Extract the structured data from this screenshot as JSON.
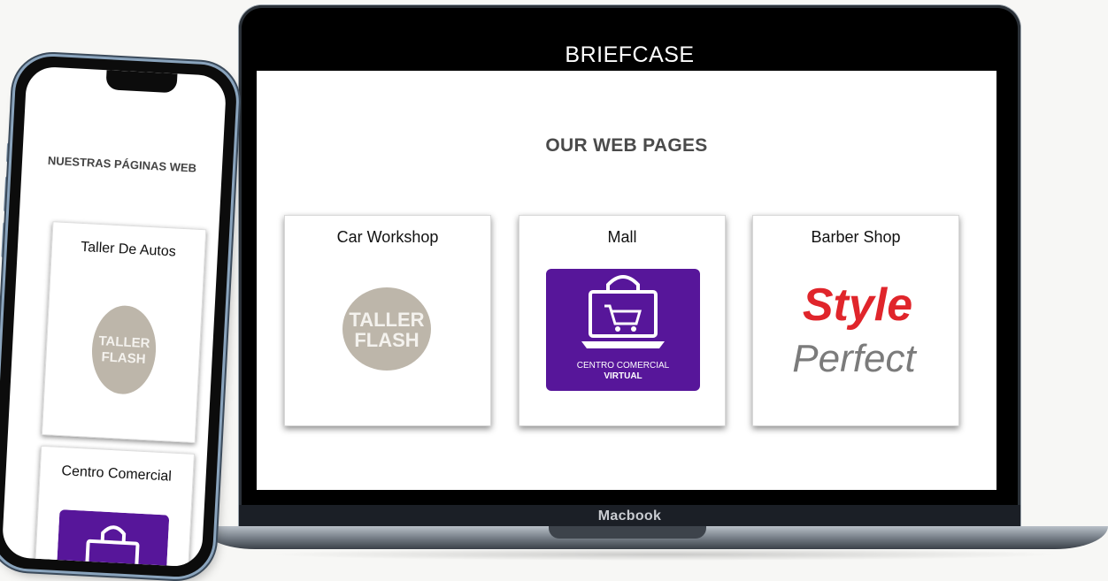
{
  "laptop": {
    "header_title": "BRIEFCASE",
    "section_title": "OUR WEB PAGES",
    "device_label": "Macbook",
    "cards": [
      {
        "title": "Car Workshop",
        "logo_line1": "TALLER",
        "logo_line2": "FLASH"
      },
      {
        "title": "Mall",
        "logo_line1": "CENTRO COMERCIAL",
        "logo_line2": "VIRTUAL"
      },
      {
        "title": "Barber Shop",
        "logo_line1": "Style",
        "logo_line2": "Perfect"
      }
    ]
  },
  "phone": {
    "section_title": "NUESTRAS PÁGINAS WEB",
    "cards": [
      {
        "title": "Taller De Autos",
        "logo_line1": "TALLER",
        "logo_line2": "FLASH"
      },
      {
        "title": "Centro Comercial"
      }
    ]
  },
  "colors": {
    "mall_purple": "#57169a",
    "taller_grey": "#bdb6aa",
    "style_red": "#e0252b",
    "perfect_grey": "#7b7b7b"
  }
}
